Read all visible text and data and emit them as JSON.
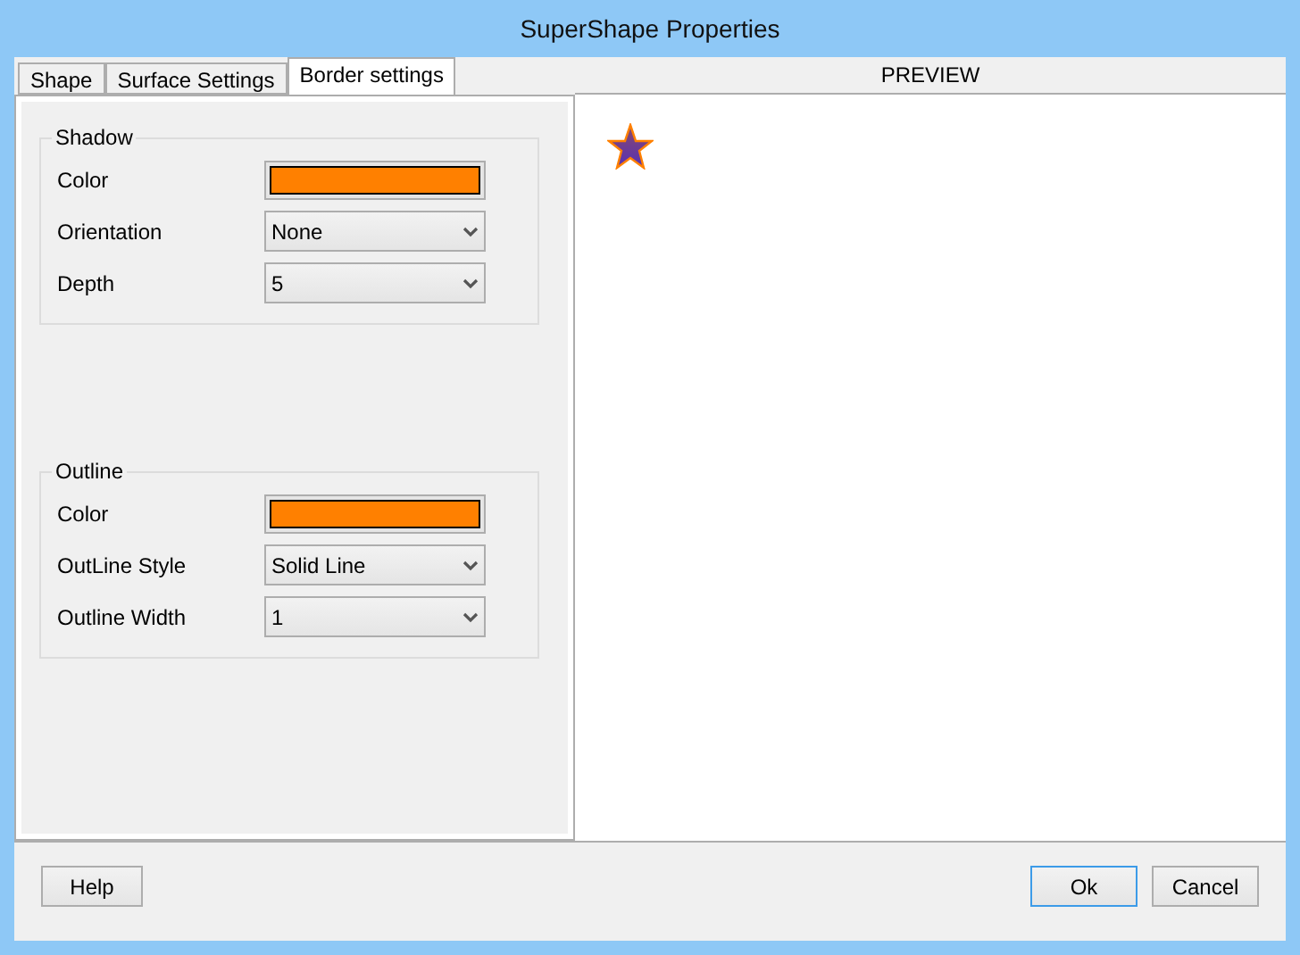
{
  "window": {
    "title": "SuperShape Properties"
  },
  "tabs": [
    {
      "label": "Shape",
      "selected": false
    },
    {
      "label": "Surface Settings",
      "selected": false
    },
    {
      "label": "Border settings",
      "selected": true
    }
  ],
  "groups": [
    {
      "title": "Shadow",
      "rows": [
        {
          "kind": "color",
          "label": "Color",
          "color": "#ff8000"
        },
        {
          "kind": "select",
          "label": "Orientation",
          "value": "None"
        },
        {
          "kind": "select",
          "label": "Depth",
          "value": "5"
        }
      ]
    },
    {
      "title": "Outline",
      "rows": [
        {
          "kind": "color",
          "label": "Color",
          "color": "#ff8000"
        },
        {
          "kind": "select",
          "label": "OutLine Style",
          "value": "Solid Line"
        },
        {
          "kind": "select",
          "label": "Outline Width",
          "value": "1"
        }
      ]
    }
  ],
  "preview": {
    "title": "PREVIEW"
  },
  "buttons": [
    {
      "label": "Help",
      "default": false
    },
    {
      "label": "Ok",
      "default": true
    },
    {
      "label": "Cancel",
      "default": false
    }
  ]
}
